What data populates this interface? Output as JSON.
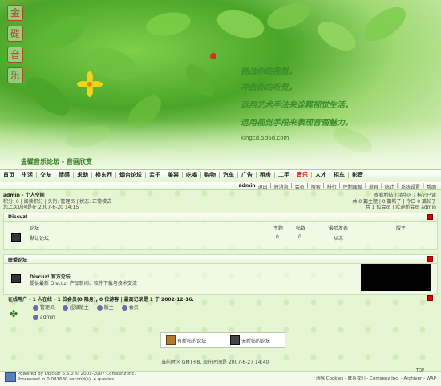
{
  "banner": {
    "logo_chars": [
      "金",
      "碟",
      "音",
      "乐"
    ],
    "poem_lines": [
      "挑战你的视觉，",
      "冲击你的听觉，",
      "运用艺术手法来诠释视觉生活，",
      "运用视觉手段来表现音画魅力。"
    ],
    "domain": "kingcd.5d6d.com"
  },
  "forum_title": "金碟音乐论坛 - 音画欣赏",
  "nav": [
    "首页",
    "生活",
    "交友",
    "情感",
    "求助",
    "换东西",
    "烟台论坛",
    "孟子",
    "美容",
    "吃喝",
    "购物",
    "汽车",
    "广告",
    "租房",
    "二手",
    "音乐",
    "人才",
    "招车",
    "影音"
  ],
  "nav_active": "音乐",
  "userbar": {
    "left": "admin 退出 | 短消息 | 会员 | 搜索 | 排行 | 控制面板 | 道具 | 统计 | 系统设置 | 帮助",
    "left_parts": [
      "admin",
      "退出",
      "短消息",
      "会员",
      "搜索",
      "排行",
      "控制面板",
      "道具",
      "统计",
      "系统设置",
      "帮助"
    ]
  },
  "space": {
    "title": "admin - 个人空间",
    "line1": "积分: 0 | 阅读积分 | 头衔: 管理员 | 状态: 正常模式",
    "line2": "您上次访问是在 2007-6-20 14:15",
    "right1": "查看新帖 | 精华区 | 标记已读",
    "right2": "共 0 篇主题 | 0 篇帖子 | 今日 0 篇帖子",
    "right3": "共 1 位会员 | 欢迎新会员 admin"
  },
  "discuz_section": {
    "name": "Discuz!",
    "columns": [
      "论坛",
      "主题",
      "帖数",
      "最后发表",
      "版主"
    ],
    "forum_name": "默认论坛",
    "topics": "0",
    "posts": "0",
    "last": "从未"
  },
  "links_section": {
    "name": "联盟论坛",
    "site_title": "Discuz! 官方论坛",
    "site_desc": "提供最新 Discuz! 产品新闻、软件下载与技术交流"
  },
  "online": {
    "header": "在线用户 - 1 人在线 - 1 位会员(0 隐身), 0 位游客 | 最高记录是 1 于 2002-12-16.",
    "legend": [
      "管理员",
      "超级版主",
      "版主",
      "会员"
    ],
    "user": "admin"
  },
  "legend": {
    "new": "有新帖的论坛",
    "none": "无新帖的论坛"
  },
  "time_line": "当前时区 GMT+8, 现在时间是 2007-6-27 14:40",
  "footer": {
    "line1": "Powered by Discuz! 5.5.0 © 2001-2007 Comsenz Inc.",
    "line2": "Processed in 0.087680 second(s), 4 queries",
    "right": "清除 Cookies - 联系我们 - Comsenz Inc. - Archiver - WAP",
    "top": "TOP"
  },
  "colors": {
    "accent": "#2f7d1a",
    "red": "#d00000",
    "bg": "#e6f5d3"
  }
}
